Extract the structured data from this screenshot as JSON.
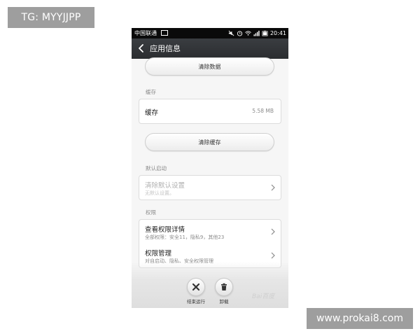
{
  "overlays": {
    "tg_badge": "TG: MYYJJPP",
    "site_badge": "www.prokai8.com"
  },
  "statusbar": {
    "carrier": "中国联通",
    "time": "20:41"
  },
  "titlebar": {
    "title": "应用信息"
  },
  "storage": {
    "clear_data_button": "清除数据"
  },
  "cache": {
    "section_label": "缓存",
    "row_label": "缓存",
    "row_value": "5.58 MB",
    "clear_cache_button": "清除缓存"
  },
  "default_launch": {
    "section_label": "默认启动",
    "row_label": "清除默认设置",
    "row_sub": "无默认设置。"
  },
  "permissions": {
    "section_label": "权限",
    "items": [
      {
        "label": "查看权限详情",
        "sub": "全部权限：安全11，隐私9，其他23"
      },
      {
        "label": "权限管理",
        "sub": "对自启动、隐私、安全权限管理"
      }
    ]
  },
  "actions": {
    "force_stop": "结束运行",
    "uninstall": "卸载"
  },
  "watermark": {
    "text": "Bai百度"
  },
  "colors": {
    "titlebar": "#2f3134",
    "statusbar": "#0a0a0a",
    "screen_bg": "#f6f6f6",
    "badge_gray": "#9e9e9e"
  }
}
